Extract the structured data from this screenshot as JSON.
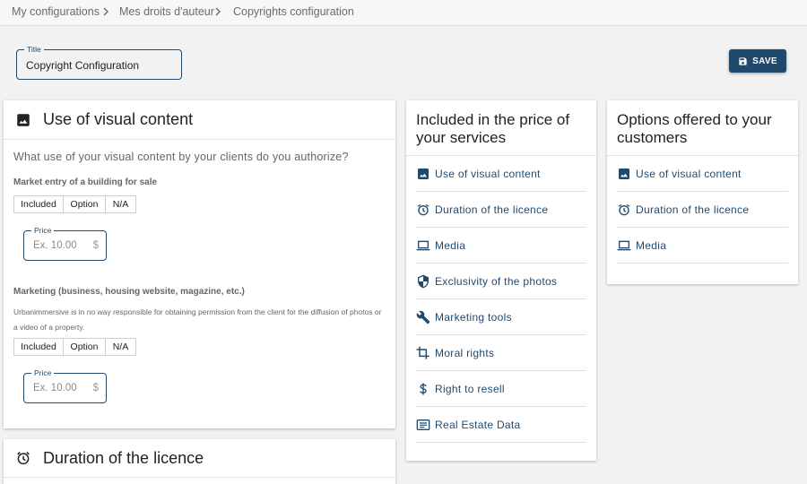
{
  "breadcrumb": [
    {
      "label": "My configurations"
    },
    {
      "label": "Mes droits d'auteur"
    },
    {
      "label": "Copyrights configuration"
    }
  ],
  "title_field": {
    "legend": "Title",
    "value": "Copyright Configuration"
  },
  "save_button": {
    "label": "SAVE",
    "icon": "save-icon"
  },
  "colors": {
    "primary": "#1f4a6e",
    "background": "#f2f2f2"
  },
  "visual_card": {
    "title": "Use of visual content",
    "icon": "image-icon",
    "question": "What use of your visual content by your clients do you authorize?",
    "sections": [
      {
        "label": "Market entry of a building for sale",
        "note": "",
        "options": [
          "Included",
          "Option",
          "N/A"
        ],
        "price": {
          "legend": "Price",
          "placeholder": "Ex. 10.00",
          "currency": "$"
        }
      },
      {
        "label": "Marketing (business, housing website, magazine, etc.)",
        "note": "Urbanimmersive is in no way responsible for obtaining permission from the client for the diffusion of photos or a video of a property.",
        "options": [
          "Included",
          "Option",
          "N/A"
        ],
        "price": {
          "legend": "Price",
          "placeholder": "Ex. 10.00",
          "currency": "$"
        }
      }
    ]
  },
  "duration_card": {
    "title": "Duration of the licence",
    "icon": "alarm-icon"
  },
  "included_card": {
    "title": "Included in the price of your services",
    "items": [
      {
        "label": "Use of visual content",
        "icon": "image-icon"
      },
      {
        "label": "Duration of the licence",
        "icon": "alarm-icon"
      },
      {
        "label": "Media",
        "icon": "laptop-icon"
      },
      {
        "label": "Exclusivity of the photos",
        "icon": "shield-icon"
      },
      {
        "label": "Marketing tools",
        "icon": "wrench-icon"
      },
      {
        "label": "Moral rights",
        "icon": "crop-icon"
      },
      {
        "label": "Right to resell",
        "icon": "dollar-icon"
      },
      {
        "label": "Real Estate Data",
        "icon": "data-icon"
      }
    ]
  },
  "options_card": {
    "title": "Options offered to your customers",
    "items": [
      {
        "label": "Use of visual content",
        "icon": "image-icon"
      },
      {
        "label": "Duration of the licence",
        "icon": "alarm-icon"
      },
      {
        "label": "Media",
        "icon": "laptop-icon"
      }
    ]
  }
}
